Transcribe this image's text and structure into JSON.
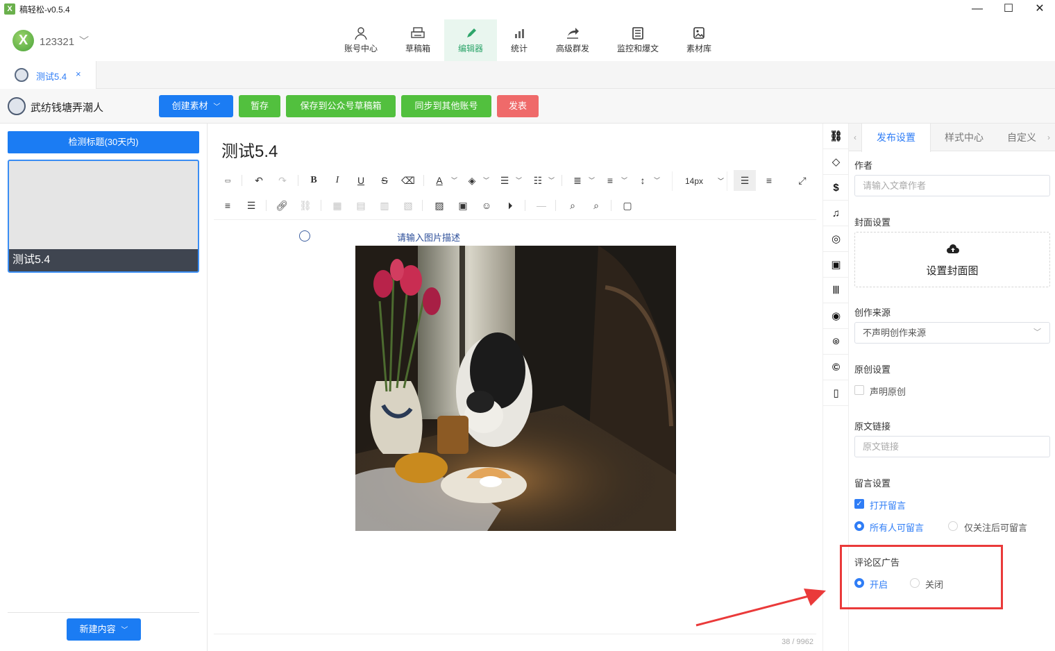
{
  "window": {
    "title": "稿轻松-v0.5.4",
    "logo_text": "X",
    "controls": {
      "minimize": "—",
      "maximize": "☐",
      "close": "✕"
    }
  },
  "account": {
    "avatar_text": "X",
    "name": "123321",
    "chevron": "﹀"
  },
  "nav": [
    {
      "label": "账号中心",
      "icon": "user-icon"
    },
    {
      "label": "草稿箱",
      "icon": "printer-icon"
    },
    {
      "label": "编辑器",
      "icon": "pencil-icon",
      "active": true
    },
    {
      "label": "统计",
      "icon": "bar-chart-icon"
    },
    {
      "label": "高级群发",
      "icon": "share-icon"
    },
    {
      "label": "监控和爆文",
      "icon": "document-icon"
    },
    {
      "label": "素材库",
      "icon": "image-icon"
    }
  ],
  "tabs": [
    {
      "label": "测试5.4",
      "close": "×"
    }
  ],
  "action_bar": {
    "account_name": "武纺钱塘弄潮人",
    "create_material": "创建素材",
    "save_temp": "暂存",
    "save_to_drafts": "保存到公众号草稿箱",
    "sync_accounts": "同步到其他账号",
    "publish": "发表",
    "colors": {
      "blue": "#1b7cf3",
      "green": "#52c03e",
      "red": "#ef6a6a"
    }
  },
  "left_panel": {
    "check_title_button": "检测标题(30天内)",
    "article_card_title": "测试5.4",
    "new_content_button": "新建内容"
  },
  "editor": {
    "title": "测试5.4",
    "font_size": "14px",
    "image_description_placeholder": "请输入图片描述",
    "word_count": "38 / 9962"
  },
  "right_panel": {
    "tabs": [
      "发布设置",
      "样式中心",
      "自定义"
    ],
    "author_label": "作者",
    "author_placeholder": "请输入文章作者",
    "cover_label": "封面设置",
    "cover_button": "设置封面图",
    "source_label": "创作来源",
    "source_value": "不声明创作来源",
    "original_label": "原创设置",
    "original_checkbox": "声明原创",
    "original_link_label": "原文链接",
    "original_link_placeholder": "原文链接",
    "comment_label": "留言设置",
    "comment_open": "打开留言",
    "comment_all": "所有人可留言",
    "comment_followers": "仅关注后可留言",
    "ad_label": "评论区广告",
    "ad_on": "开启",
    "ad_off": "关闭"
  },
  "colors": {
    "accent": "#2f7df6",
    "nav_active_bg": "#e9f6ef",
    "annotation": "#ea3a3a"
  }
}
